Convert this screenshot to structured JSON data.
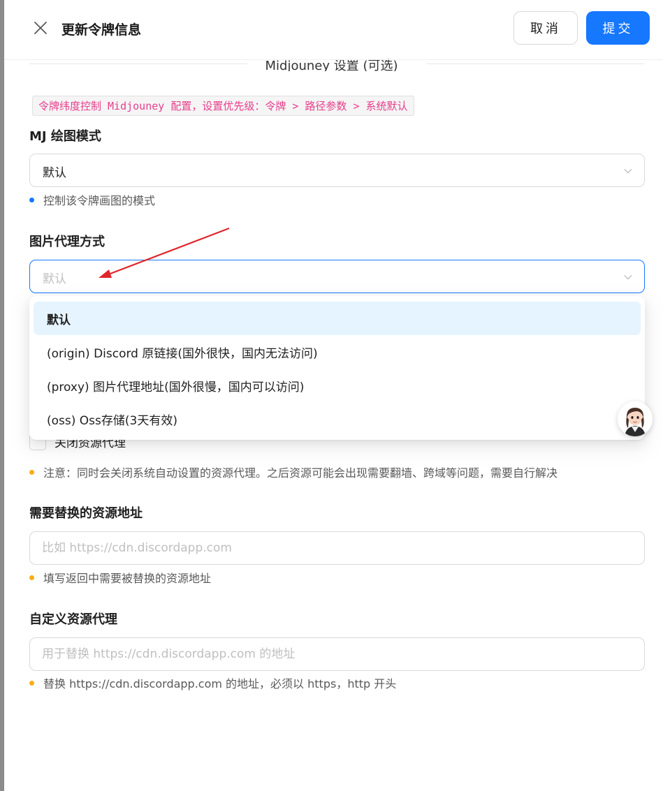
{
  "header": {
    "title": "更新令牌信息",
    "cancel_label": "取消",
    "submit_label": "提交"
  },
  "section": {
    "title": "Midjouney 设置 (可选)",
    "priority_note": "令牌纬度控制 Midjouney 配置，设置优先级：令牌 > 路径参数 > 系统默认"
  },
  "mj_mode": {
    "label": "MJ 绘图模式",
    "value": "默认",
    "hint": "控制该令牌画图的模式"
  },
  "image_proxy": {
    "label": "图片代理方式",
    "placeholder": "默认",
    "options": [
      "默认",
      "(origin) Discord 原链接(国外很快，国内无法访问)",
      "(proxy) 图片代理地址(国外很慢，国内可以访问)",
      "(oss) Oss存储(3天有效)"
    ],
    "selected_index": 0
  },
  "close_proxy": {
    "label": "关闭资源代理",
    "checked": false,
    "hint": "注意：同时会关闭系统自动设置的资源代理。之后资源可能会出现需要翻墙、跨域等问题，需要自行解决"
  },
  "replace_url": {
    "label": "需要替换的资源地址",
    "placeholder": "比如 https://cdn.discordapp.com",
    "hint": "填写返回中需要被替换的资源地址"
  },
  "custom_proxy": {
    "label": "自定义资源代理",
    "placeholder": "用于替换 https://cdn.discordapp.com 的地址",
    "hint": "替换 https://cdn.discordapp.com 的地址，必须以 https，http 开头"
  },
  "colors": {
    "primary": "#1677ff",
    "annotation_arrow": "#e0262b",
    "hint_blue": "#1677ff",
    "hint_orange": "#faad14",
    "code_text": "#e83e8c"
  }
}
